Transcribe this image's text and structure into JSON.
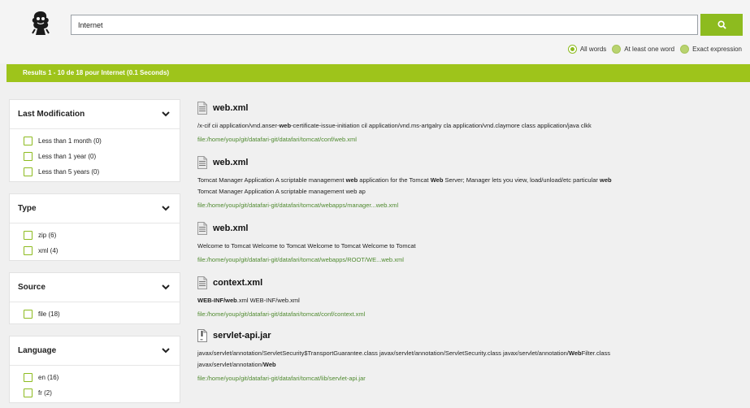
{
  "search": {
    "value": "Internet"
  },
  "match_options": [
    {
      "label": "All words",
      "selected": true
    },
    {
      "label": "At least one word",
      "selected": false
    },
    {
      "label": "Exact expression",
      "selected": false
    }
  ],
  "results_summary": "Results 1 - 10 de 18 pour Internet (0.1 Seconds)",
  "facets": [
    {
      "title": "Last Modification",
      "items": [
        "Less than 1 month (0)",
        "Less than 1 year (0)",
        "Less than 5 years (0)"
      ]
    },
    {
      "title": "Type",
      "items": [
        "zip (6)",
        "xml (4)"
      ]
    },
    {
      "title": "Source",
      "items": [
        "file (18)"
      ]
    },
    {
      "title": "Language",
      "items": [
        "en (16)",
        "fr (2)"
      ]
    }
  ],
  "results": [
    {
      "icon": "xml-file-icon",
      "title": "web.xml",
      "snippet": [
        [
          [
            "/x-cif cii application/vnd.anser-",
            false
          ],
          [
            "web",
            true
          ],
          [
            "-certificate-issue-initiation cil application/vnd.ms-artgalry cla application/vnd.claymore class application/java clkk",
            false
          ]
        ]
      ],
      "url": "file:/home/youp/git/datafari-git/datafari/tomcat/conf/web.xml"
    },
    {
      "icon": "xml-file-icon",
      "title": "web.xml",
      "snippet": [
        [
          [
            "Tomcat Manager Application A scriptable management ",
            false
          ],
          [
            "web",
            true
          ],
          [
            " application for the Tomcat ",
            false
          ],
          [
            "Web",
            true
          ],
          [
            " Server; Manager lets you view, load/unload/etc particular ",
            false
          ],
          [
            "web",
            true
          ]
        ],
        [
          [
            "Tomcat Manager Application A scriptable management web ap",
            false
          ]
        ]
      ],
      "url": "file:/home/youp/git/datafari-git/datafari/tomcat/webapps/manager...web.xml"
    },
    {
      "icon": "xml-file-icon",
      "title": "web.xml",
      "snippet": [
        [
          [
            "Welcome to Tomcat Welcome to Tomcat Welcome to Tomcat Welcome to Tomcat",
            false
          ]
        ]
      ],
      "url": "file:/home/youp/git/datafari-git/datafari/tomcat/webapps/ROOT/WE...web.xml"
    },
    {
      "icon": "xml-file-icon",
      "title": "context.xml",
      "snippet": [
        [
          [
            "WEB-INF/",
            true
          ],
          [
            "web",
            true
          ],
          [
            ".xml WEB-INF/web.xml",
            false
          ]
        ]
      ],
      "url": "file:/home/youp/git/datafari-git/datafari/tomcat/conf/context.xml"
    },
    {
      "icon": "jar-file-icon",
      "title": "servlet-api.jar",
      "snippet": [
        [
          [
            "javax/servlet/annotation/ServletSecurity$TransportGuarantee.class javax/servlet/annotation/ServletSecurity.class javax/servlet/annotation/",
            false
          ],
          [
            "Web",
            true
          ],
          [
            "Filter.class",
            false
          ]
        ],
        [
          [
            "javax/servlet/annotation/",
            false
          ],
          [
            "Web",
            true
          ]
        ]
      ],
      "url": "file:/home/youp/git/datafari-git/datafari/tomcat/lib/servlet-api.jar"
    }
  ],
  "colors": {
    "accent": "#8dbb1f",
    "results_bar": "#9ec41b",
    "url": "#4f8a2f"
  }
}
